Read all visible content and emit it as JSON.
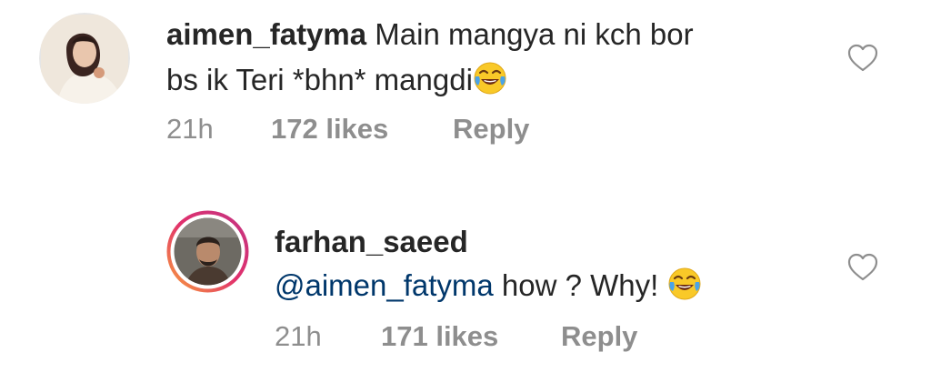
{
  "comments": [
    {
      "username": "aimen_fatyma",
      "text_line1": "Main mangya ni kch bor",
      "text_line2": "bs ik Teri *bhn* mangdi",
      "emoji": "face-with-tears-of-joy",
      "time": "21h",
      "likes": "172 likes",
      "reply": "Reply",
      "avatar": "profile-photo"
    },
    {
      "username": "farhan_saeed",
      "mention": "@aimen_fatyma",
      "text_rest": " how ? Why! ",
      "emoji": "face-with-tears-of-joy",
      "time": "21h",
      "likes": "171 likes",
      "reply": "Reply",
      "avatar": "profile-photo-story-ring"
    }
  ],
  "colors": {
    "text": "#262626",
    "meta": "#8e8e8e",
    "mention": "#00376b",
    "emoji_face": "#f9c928",
    "story_ring_start": "#f9a53b",
    "story_ring_end": "#c13584"
  },
  "icons": [
    "heart-outline-icon",
    "face-with-tears-of-joy"
  ]
}
